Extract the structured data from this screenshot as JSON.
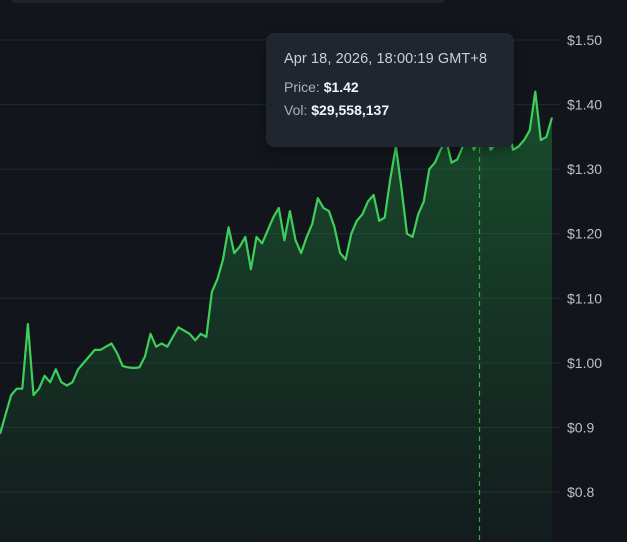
{
  "colors": {
    "background": "#12161c",
    "grid": "#232a33",
    "line": "#3ecf5a",
    "fill_top": "#1f7a3a",
    "crosshair": "#2fae4d",
    "axis_text": "#b9c0c8"
  },
  "tooltip": {
    "date": "Apr 18, 2026, 18:00:19 GMT+8",
    "price_label": "Price:",
    "price_value": "$1.42",
    "vol_label": "Vol:",
    "vol_value": "$29,558,137"
  },
  "chart_data": {
    "type": "area",
    "ylabel": "",
    "xlabel": "",
    "grid": true,
    "y_axis_position": "right",
    "y_ticks": [
      "$0.8",
      "$0.9",
      "$1.00",
      "$1.10",
      "$1.20",
      "$1.30",
      "$1.40",
      "$1.50"
    ],
    "y_tick_values": [
      0.8,
      0.9,
      1.0,
      1.1,
      1.2,
      1.3,
      1.4,
      1.5
    ],
    "ylim": [
      0.72,
      1.58
    ],
    "hovered_index": 86,
    "series": [
      {
        "values": [
          0.89,
          0.92,
          0.95,
          0.96,
          0.96,
          1.06,
          0.95,
          0.96,
          0.98,
          0.97,
          0.99,
          0.97,
          0.965,
          0.97,
          0.99,
          1.0,
          1.01,
          1.02,
          1.02,
          1.025,
          1.03,
          1.015,
          0.995,
          0.993,
          0.992,
          0.993,
          1.01,
          1.045,
          1.025,
          1.03,
          1.025,
          1.04,
          1.055,
          1.05,
          1.045,
          1.035,
          1.045,
          1.04,
          1.11,
          1.13,
          1.16,
          1.21,
          1.17,
          1.18,
          1.195,
          1.145,
          1.195,
          1.185,
          1.205,
          1.225,
          1.24,
          1.19,
          1.235,
          1.19,
          1.17,
          1.195,
          1.215,
          1.255,
          1.24,
          1.235,
          1.21,
          1.17,
          1.16,
          1.2,
          1.22,
          1.23,
          1.25,
          1.26,
          1.22,
          1.225,
          1.285,
          1.335,
          1.27,
          1.2,
          1.195,
          1.23,
          1.25,
          1.3,
          1.31,
          1.33,
          1.345,
          1.31,
          1.315,
          1.335,
          1.37,
          1.33,
          1.35,
          1.37,
          1.33,
          1.34,
          1.39,
          1.375,
          1.33,
          1.335,
          1.345,
          1.36,
          1.42,
          1.345,
          1.35,
          1.38
        ]
      }
    ]
  }
}
